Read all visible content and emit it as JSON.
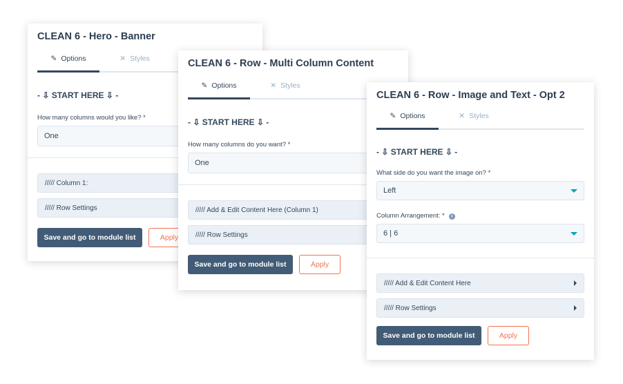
{
  "colors": {
    "primary_button": "#425b76",
    "apply_accent": "#f2754e",
    "caret": "#00a4bd",
    "field_bg": "#f5f8fa"
  },
  "panels": [
    {
      "title": "CLEAN 6 - Hero - Banner",
      "tabs": [
        "Options",
        "Styles"
      ],
      "start": "- ⇩ START HERE ⇩ -",
      "fields": [
        {
          "label": "How many columns would you like? *",
          "value": "One"
        }
      ],
      "sections": [
        "///// Column 1:",
        "///// Row Settings"
      ],
      "save": "Save and go to module list",
      "apply": "Apply"
    },
    {
      "title": "CLEAN 6 - Row - Multi Column Content",
      "tabs": [
        "Options",
        "Styles"
      ],
      "start": "- ⇩ START HERE ⇩ -",
      "fields": [
        {
          "label": "How many columns do you want? *",
          "value": "One"
        }
      ],
      "sections": [
        "///// Add & Edit Content Here (Column 1)",
        "///// Row Settings"
      ],
      "save": "Save and go to module list",
      "apply": "Apply"
    },
    {
      "title": "CLEAN 6 - Row - Image and Text - Opt 2",
      "tabs": [
        "Options",
        "Styles"
      ],
      "start": "- ⇩ START HERE ⇩ -",
      "fields": [
        {
          "label": "What side do you want the image on? *",
          "value": "Left"
        },
        {
          "label": "Column Arrangement: *",
          "value": "6 | 6",
          "info": "i"
        }
      ],
      "sections": [
        "///// Add & Edit Content Here",
        "///// Row Settings"
      ],
      "save": "Save and go to module list",
      "apply": "Apply"
    }
  ]
}
